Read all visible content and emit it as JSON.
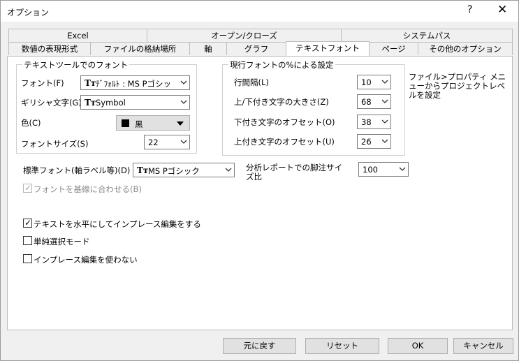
{
  "window": {
    "title": "オプション",
    "help": "?",
    "close": "✕"
  },
  "tabs": {
    "row1": [
      "Excel",
      "オープン/クローズ",
      "システムパス"
    ],
    "row2": [
      "数値の表現形式",
      "ファイルの格納場所",
      "軸",
      "グラフ",
      "テキストフォント",
      "ページ",
      "その他のオプション"
    ],
    "active": "テキストフォント"
  },
  "text_tool_font": {
    "title": "テキストツールでのフォント",
    "font_label": "フォント(F)",
    "font_value": "ﾃﾞﾌｫﾙﾄ : MS Pゴシッ",
    "greek_label": "ギリシャ文字(G)",
    "greek_value": "Symbol",
    "color_label": "色(C)",
    "color_value": "黒",
    "color_swatch": "#000000",
    "size_label": "フォントサイズ(S)",
    "size_value": "22"
  },
  "percent_settings": {
    "title": "現行フォントの%による設定",
    "line_spacing_label": "行間隔(L)",
    "line_spacing_value": "10",
    "supsub_size_label": "上/下付き文字の大きさ(Z)",
    "supsub_size_value": "68",
    "sub_offset_label": "下付き文字のオフセット(O)",
    "sub_offset_value": "38",
    "sup_offset_label": "上付き文字のオフセット(U)",
    "sup_offset_value": "26"
  },
  "note": "ファイル>プロパティ メニューからプロジェクトレベルを設定",
  "standard_font": {
    "label": "標準フォント(軸ラベル等)(D)",
    "value": "MS Pゴシック"
  },
  "footnote": {
    "label": "分析レポートでの脚注サイズ比",
    "value": "100"
  },
  "baseline_checkbox": {
    "label": "フォントを基線に合わせる(B)",
    "checked": true
  },
  "checkboxes": {
    "horizontal": {
      "label": "テキストを水平にしてインプレース編集をする",
      "checked": true
    },
    "simple_select": {
      "label": "単純選択モード",
      "checked": false
    },
    "no_inplace": {
      "label": "インプレース編集を使わない",
      "checked": false
    }
  },
  "buttons": {
    "revert": "元に戻す",
    "reset": "リセット",
    "ok": "OK",
    "cancel": "キャンセル"
  },
  "icons": {
    "font_icon": "Tт",
    "check": "✓"
  }
}
